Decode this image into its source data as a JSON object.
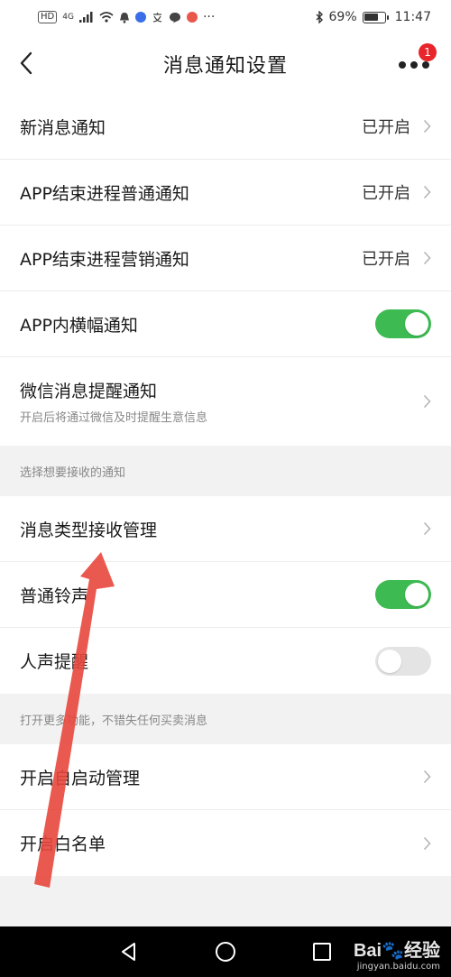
{
  "status_bar": {
    "network_tag": "HD",
    "network_gen": "4G",
    "extra": "···",
    "battery_percent": "69%",
    "battery_level": 0.69,
    "time": "11:47"
  },
  "nav": {
    "title": "消息通知设置",
    "badge_count": "1"
  },
  "group1": [
    {
      "label": "新消息通知",
      "value": "已开启"
    },
    {
      "label": "APP结束进程普通通知",
      "value": "已开启"
    },
    {
      "label": "APP结束进程营销通知",
      "value": "已开启"
    },
    {
      "label": "APP内横幅通知",
      "toggle": true
    },
    {
      "label": "微信消息提醒通知",
      "sublabel": "开启后将通过微信及时提醒生意信息"
    }
  ],
  "section1_header": "选择想要接收的通知",
  "group2": [
    {
      "label": "消息类型接收管理"
    },
    {
      "label": "普通铃声",
      "toggle": true
    },
    {
      "label": "人声提醒",
      "toggle": false
    }
  ],
  "section2_header": "打开更多功能，不错失任何买卖消息",
  "group3": [
    {
      "label": "开启自启动管理"
    },
    {
      "label": "开启白名单"
    }
  ],
  "watermark": {
    "logo": "Bai🐾经验",
    "url": "jingyan.baidu.com"
  },
  "colors": {
    "toggle_on": "#3dbb52",
    "toggle_off": "#e4e4e4",
    "badge": "#e8252a",
    "annotation_arrow": "#e8473c"
  }
}
